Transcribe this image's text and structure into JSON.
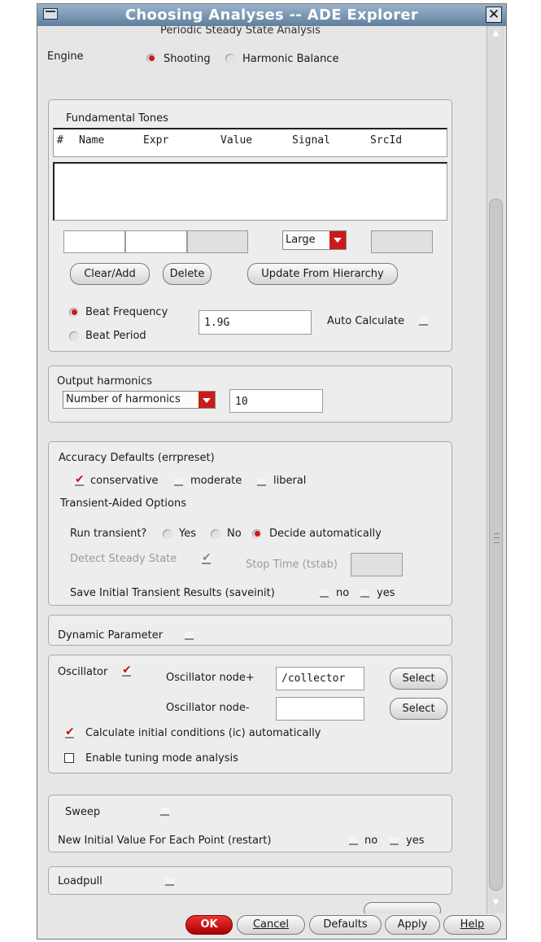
{
  "window": {
    "title": "Choosing Analyses -- ADE Explorer"
  },
  "header_cut": "Periodic Steady State Analysis",
  "engine": {
    "label": "Engine",
    "options": [
      "Shooting",
      "Harmonic Balance"
    ],
    "selected": "Shooting"
  },
  "tones": {
    "title": "Fundamental Tones",
    "columns": [
      "#",
      "Name",
      "Expr",
      "Value",
      "Signal",
      "SrcId"
    ],
    "signal_select": "Large",
    "buttons": {
      "clear_add": "Clear/Add",
      "delete": "Delete",
      "update": "Update From Hierarchy"
    },
    "beat_frequency": "Beat Frequency",
    "beat_period": "Beat Period",
    "beat_value": "1.9G",
    "auto_calculate": "Auto Calculate"
  },
  "output": {
    "title": "Output harmonics",
    "select": "Number of harmonics",
    "value": "10"
  },
  "accuracy": {
    "title": "Accuracy Defaults (errpreset)",
    "options": [
      "conservative",
      "moderate",
      "liberal"
    ],
    "checked": "conservative",
    "transient_title": "Transient-Aided Options",
    "run_transient": "Run transient?",
    "run_options": [
      "Yes",
      "No",
      "Decide automatically"
    ],
    "run_selected": "Decide automatically",
    "detect": "Detect Steady State",
    "stop_time": "Stop Time (tstab)",
    "save_initial": "Save Initial Transient Results (saveinit)",
    "no": "no",
    "yes": "yes"
  },
  "dynamic": {
    "label": "Dynamic Parameter"
  },
  "oscillator": {
    "label": "Oscillator",
    "node_plus": "Oscillator node+",
    "node_plus_value": "/collector",
    "node_minus": "Oscillator node-",
    "node_minus_value": "",
    "select": "Select",
    "calc_ic": "Calculate initial conditions (ic) automatically",
    "tuning": "Enable tuning mode analysis"
  },
  "sweep": {
    "label": "Sweep",
    "restart": "New Initial Value For Each Point (restart)",
    "no": "no",
    "yes": "yes"
  },
  "loadpull": {
    "label": "Loadpull"
  },
  "footer": {
    "ok": "OK",
    "cancel": "Cancel",
    "defaults": "Defaults",
    "apply": "Apply",
    "help": "Help"
  },
  "colors": {
    "accent": "#d01818",
    "title_bar": "#5f7f9e",
    "panel": "#ededed"
  },
  "icons": [
    "window-menu-icon",
    "close-icon",
    "dropdown-arrow-icon",
    "scroll-up-icon",
    "scroll-down-icon"
  ]
}
